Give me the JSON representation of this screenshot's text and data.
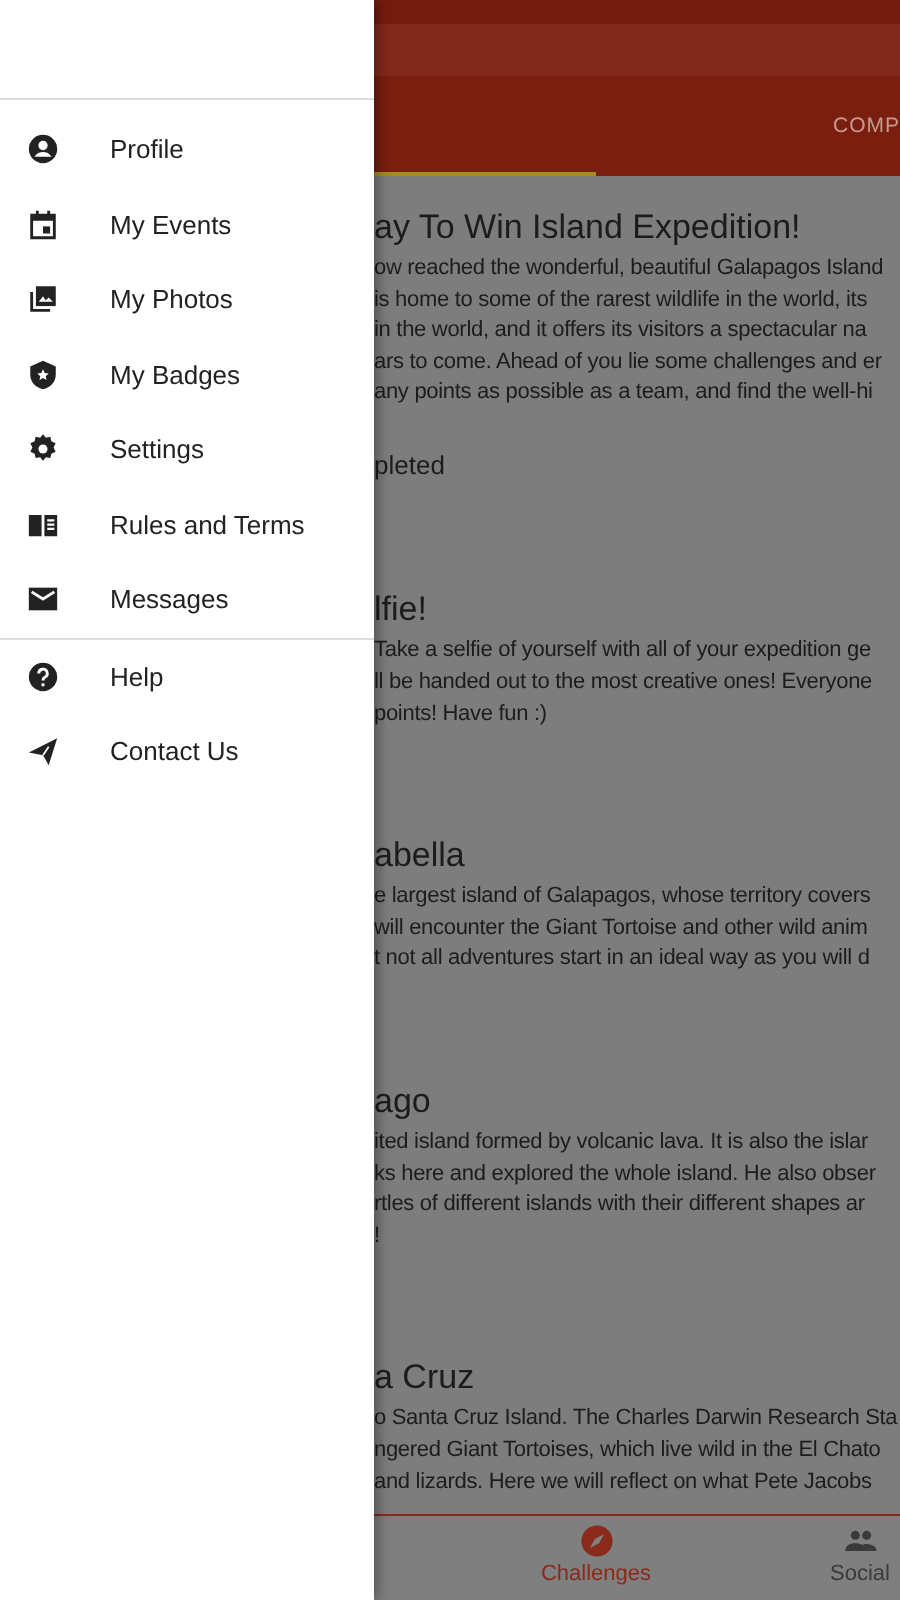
{
  "drawer": {
    "groups": [
      [
        {
          "label": "Profile"
        },
        {
          "label": "My Events"
        },
        {
          "label": "My Photos"
        },
        {
          "label": "My Badges"
        },
        {
          "label": "Settings"
        },
        {
          "label": "Rules and Terms"
        },
        {
          "label": "Messages"
        }
      ],
      [
        {
          "label": "Help"
        },
        {
          "label": "Contact Us"
        }
      ]
    ]
  },
  "tabs": [
    {
      "selected": true
    },
    {
      "label": "COMP",
      "selected": false
    }
  ],
  "challenges": [
    {
      "title": "ay To Win Island Expedition!",
      "lines": [
        "ow reached the wonderful, beautiful Galapagos Island",
        "is home to some of the rarest wildlife in the world, its",
        "in the world, and it offers its visitors a spectacular na",
        "ars to come. Ahead of you lie some challenges and er",
        "any points as possible as a team, and find the well-hi"
      ],
      "status": "pleted"
    },
    {
      "title": "lfie!",
      "lines": [
        "Take a selfie of yourself with all of your expedition ge",
        "ll be handed out to the most creative ones! Everyone",
        "points! Have fun :)"
      ]
    },
    {
      "title": "abella",
      "lines": [
        "e largest island of Galapagos, whose territory covers",
        "will encounter the Giant Tortoise and other wild anim",
        "t not all adventures start in an ideal way as you will d"
      ]
    },
    {
      "title": "ago",
      "lines": [
        "ited island formed by volcanic lava. It is also the islar",
        "ks here and explored the whole island. He also obser",
        "rtles of different islands with their different shapes ar",
        "!"
      ]
    },
    {
      "title": "a Cruz",
      "lines": [
        "o Santa Cruz Island. The Charles Darwin Research Sta",
        "ngered Giant Tortoises, which live wild in the El Chato",
        "and lizards. Here we will reflect on what Pete Jacobs"
      ]
    }
  ],
  "bottom_nav": [
    {
      "label": "Challenges",
      "selected": true
    },
    {
      "label": "Social",
      "selected": false
    }
  ]
}
